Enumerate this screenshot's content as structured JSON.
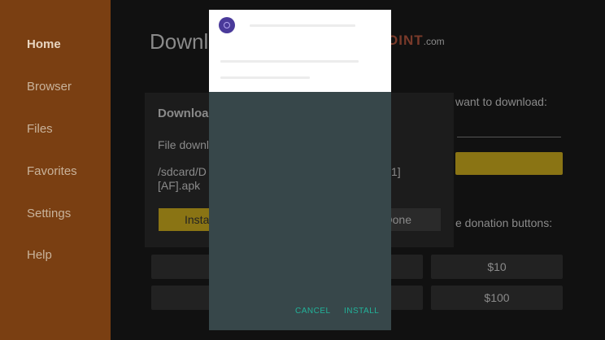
{
  "sidebar": {
    "items": [
      {
        "label": "Home",
        "active": true
      },
      {
        "label": "Browser"
      },
      {
        "label": "Files"
      },
      {
        "label": "Favorites"
      },
      {
        "label": "Settings"
      },
      {
        "label": "Help"
      }
    ]
  },
  "main": {
    "title": "Downl",
    "brand": "OINT",
    "brand_suffix": ".com",
    "want_text": "want to download:",
    "donation_text": "e donation buttons:",
    "donations": [
      "$10",
      "$100"
    ]
  },
  "download_dialog": {
    "title": "Downloa",
    "line1": "File downl",
    "path": "/sdcard/D",
    "path_line2": "[AF].apk",
    "path_end": "1]",
    "install_label": "Insta",
    "done_label": "Done"
  },
  "installer": {
    "cancel_label": "CANCEL",
    "install_label": "INSTALL",
    "colors": {
      "header": "#ffffff",
      "body": "#37474a",
      "accent": "#22b39a",
      "icon": "#4a3a9a"
    }
  }
}
